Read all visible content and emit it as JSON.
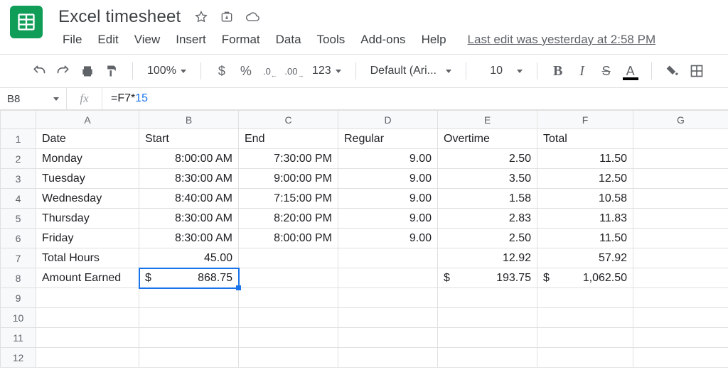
{
  "doc": {
    "title": "Excel timesheet"
  },
  "menus": {
    "file": "File",
    "edit": "Edit",
    "view": "View",
    "insert": "Insert",
    "format": "Format",
    "data": "Data",
    "tools": "Tools",
    "addons": "Add-ons",
    "help": "Help",
    "last_edit": "Last edit was yesterday at 2:58 PM"
  },
  "toolbar": {
    "zoom": "100%",
    "dollar": "$",
    "percent": "%",
    "dec_dec": ".0",
    "dec_inc": ".00",
    "more_fmt": "123",
    "font": "Default (Ari...",
    "size": "10",
    "bold": "B",
    "italic": "I",
    "strike": "S",
    "textcolor": "A"
  },
  "formula": {
    "name_box": "B8",
    "fx": "fx",
    "prefix": "=F7*",
    "literal": "15"
  },
  "colHeaders": [
    "A",
    "B",
    "C",
    "D",
    "E",
    "F",
    "G"
  ],
  "rowCount": 12,
  "activeCell": {
    "row": 8,
    "col": "B"
  },
  "cells": {
    "A1": "Date",
    "B1": "Start",
    "C1": "End",
    "D1": "Regular",
    "E1": "Overtime",
    "F1": "Total",
    "A2": "Monday",
    "B2": "8:00:00 AM",
    "C2": "7:30:00 PM",
    "D2": "9.00",
    "E2": "2.50",
    "F2": "11.50",
    "A3": "Tuesday",
    "B3": "8:30:00 AM",
    "C3": "9:00:00 PM",
    "D3": "9.00",
    "E3": "3.50",
    "F3": "12.50",
    "A4": "Wednesday",
    "B4": "8:40:00 AM",
    "C4": "7:15:00 PM",
    "D4": "9.00",
    "E4": "1.58",
    "F4": "10.58",
    "A5": "Thursday",
    "B5": "8:30:00 AM",
    "C5": "8:20:00 PM",
    "D5": "9.00",
    "E5": "2.83",
    "F5": "11.83",
    "A6": "Friday",
    "B6": "8:30:00 AM",
    "C6": "8:00:00 PM",
    "D6": "9.00",
    "E6": "2.50",
    "F6": "11.50",
    "A7": "Total Hours",
    "B7": "45.00",
    "E7": "12.92",
    "F7": "57.92",
    "A8": "Amount Earned",
    "B8": "868.75",
    "E8": "193.75",
    "F8": "1,062.50"
  },
  "currencyCells": [
    "B8",
    "E8",
    "F8"
  ],
  "leftAlignCols": [
    "A"
  ],
  "leftAlignCells": [
    "B1",
    "C1",
    "D1",
    "E1",
    "F1"
  ]
}
